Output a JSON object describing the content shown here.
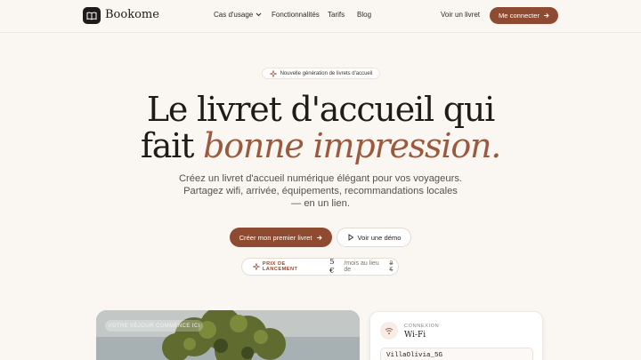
{
  "nav": {
    "brand": "Bookome",
    "links": [
      "Cas d'usage",
      "Fonctionnalités",
      "Tarifs",
      "Blog"
    ],
    "secondary": "Voir un livret",
    "cta": "Me connecter"
  },
  "hero": {
    "badge": "Nouvelle génération de livrets d'accueil",
    "title_line1": "Le livret d'accueil qui",
    "title_line2_plain": "fait",
    "title_line2_accent": "bonne impression.",
    "subtitle": "Créez un livret d'accueil numérique élégant pour vos voyageurs. Partagez wifi, arrivée, équipements, recommandations locales — en un lien.",
    "primary_cta": "Créer mon premier livret",
    "secondary_cta": "Voir une démo",
    "price": {
      "label": "PRIX DE LANCEMENT",
      "value": "5 €",
      "per": "/mois au lieu de",
      "old": "9 €"
    }
  },
  "preview": {
    "photo_tag": "VOTRE SÉJOUR COMMENCE ICI",
    "wifi_label": "CONNEXION",
    "wifi_title": "Wi-Fi",
    "ssid": "VillaOlivia_5G"
  },
  "colors": {
    "accent": "#8e4b32",
    "accent_text": "#9b5a3e",
    "background": "#faf6f2",
    "ink": "#1f1b18"
  }
}
